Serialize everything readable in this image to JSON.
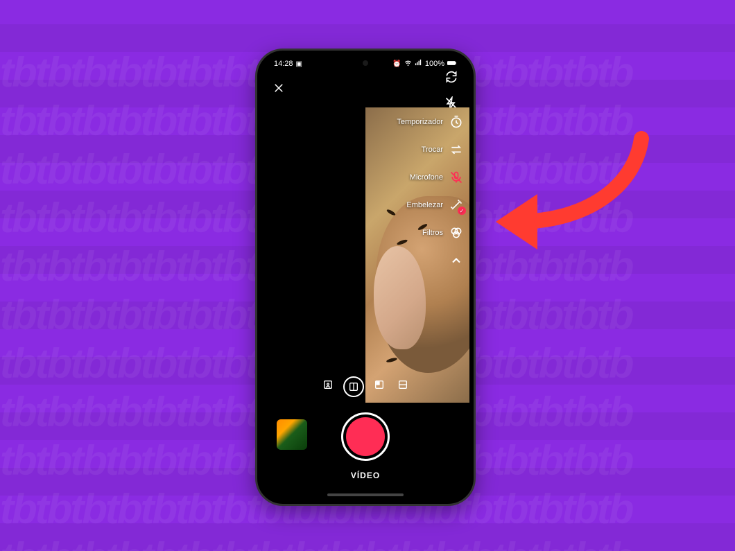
{
  "status": {
    "time": "14:28",
    "battery_text": "100%"
  },
  "tools": {
    "timer": "Temporizador",
    "swap": "Trocar",
    "mic": "Microfone",
    "beautify": "Embelezar",
    "filters": "Filtros"
  },
  "mode": {
    "video": "VÍDEO"
  },
  "colors": {
    "accent": "#ff2d55",
    "background": "#8A2BE2"
  }
}
